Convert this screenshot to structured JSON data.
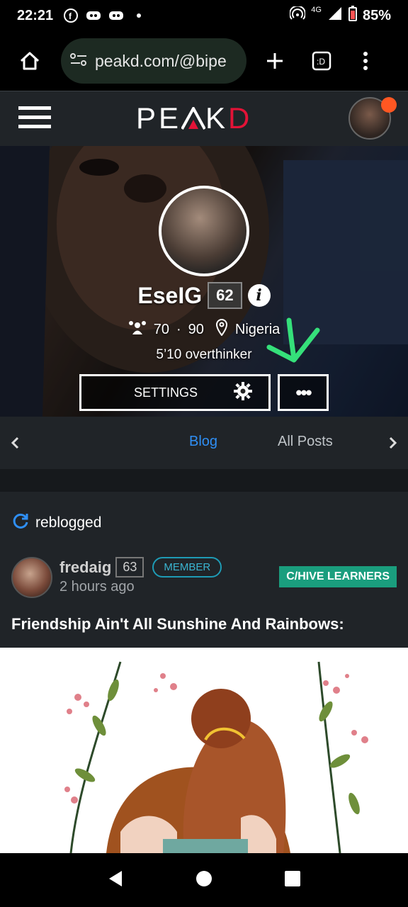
{
  "status_bar": {
    "time": "22:21",
    "battery": "85%",
    "network": "4G"
  },
  "browser": {
    "url": "peakd.com/@bipe"
  },
  "header": {
    "logo_text_left": "PE",
    "logo_text_mid": "K",
    "logo_text_right": "D",
    "brand_color": "#e31337"
  },
  "profile": {
    "name": "EseIG",
    "reputation": "62",
    "followers": "70",
    "following": "90",
    "location": "Nigeria",
    "bio": "5’10 overthinker",
    "settings_label": "SETTINGS",
    "more_label": "•••"
  },
  "tabs": [
    {
      "label": "Blog",
      "active": true
    },
    {
      "label": "All Posts",
      "active": false
    }
  ],
  "post": {
    "reblogged_label": "reblogged",
    "author": "fredaig",
    "author_reputation": "63",
    "member_label": "MEMBER",
    "time": "2 hours ago",
    "community": "C/HIVE LEARNERS",
    "title": "Friendship Ain't All Sunshine And Rainbows:"
  },
  "colors": {
    "accent_blue": "#2f8ff5",
    "community_green": "#1a9e7e",
    "annotation_green": "#35e07a"
  }
}
